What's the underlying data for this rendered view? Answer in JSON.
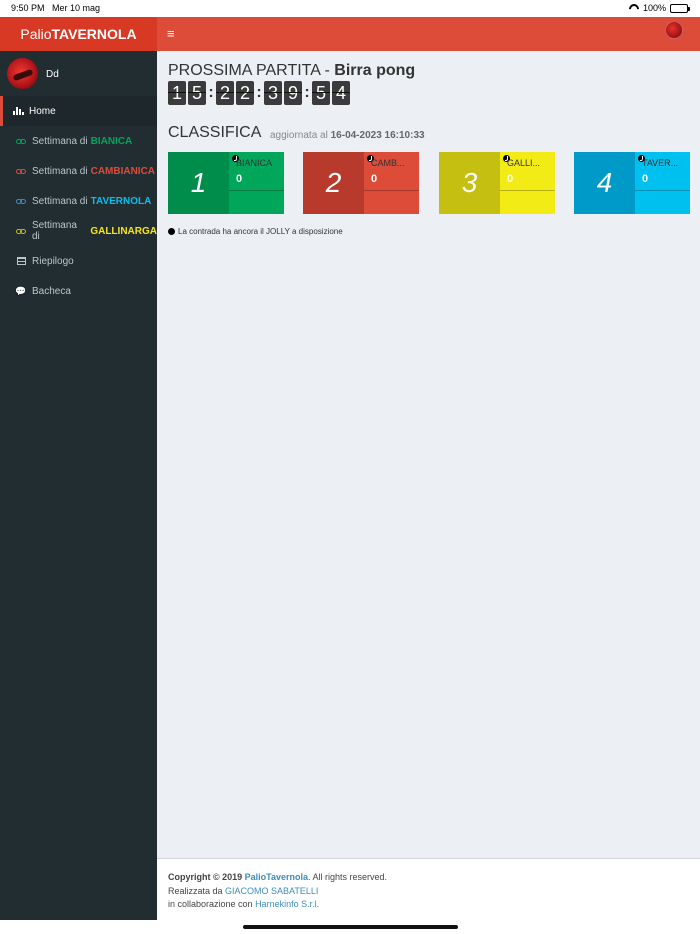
{
  "status_bar": {
    "time": "9:50 PM",
    "date": "Mer 10 mag",
    "battery": "100%"
  },
  "header": {
    "logo_light": "Palio",
    "logo_bold": "TAVERNOLA",
    "menu_icon": "hamburger-icon"
  },
  "user": {
    "name": "Dd"
  },
  "sidebar": {
    "items": [
      {
        "label": "Home",
        "icon": "bar-chart-icon",
        "active": true
      },
      {
        "label": "Settimana di ",
        "team": "BIANICA",
        "team_color": "#00a65a",
        "icon": "chain-icon"
      },
      {
        "label": "Settimana di ",
        "team": "CAMBIANICA",
        "team_color": "#dd4b39",
        "icon": "chain-icon"
      },
      {
        "label": "Settimana di ",
        "team": "TAVERNOLA",
        "team_color": "#00c0ef",
        "icon": "chain-icon"
      },
      {
        "label": "Settimana di ",
        "team": "GALLINARGA",
        "team_color": "#f5e61b",
        "icon": "chain-icon"
      },
      {
        "label": "Riepilogo",
        "icon": "table-icon"
      },
      {
        "label": "Bacheca",
        "icon": "comments-icon"
      }
    ]
  },
  "next_match": {
    "prefix": "PROSSIMA PARTITA - ",
    "name": "Birra pong",
    "countdown": [
      "1",
      "5",
      "2",
      "2",
      "3",
      "9",
      "5",
      "4"
    ]
  },
  "ranking": {
    "title": "CLASSIFICA",
    "updated_prefix": "aggiornata al ",
    "updated_value": "16-04-2023 16:10:33",
    "cards": [
      {
        "rank": "1",
        "name": "BIANICA",
        "score": "0",
        "dark": "#008d4c",
        "light": "#00a65a",
        "jolly": true
      },
      {
        "rank": "2",
        "name": "CAMB...",
        "score": "0",
        "dark": "#b83a2c",
        "light": "#dd4b39",
        "jolly": true
      },
      {
        "rank": "3",
        "name": "GALLI...",
        "score": "0",
        "dark": "#c5bf12",
        "light": "#f3eb15",
        "jolly": true
      },
      {
        "rank": "4",
        "name": "TAVER...",
        "score": "0",
        "dark": "#009ac8",
        "light": "#00c0ef",
        "jolly": true
      }
    ],
    "jolly_note": "La contrada ha ancora il JOLLY a disposizione"
  },
  "footer": {
    "copyright": "Copyright © 2019 ",
    "brand": "PalioTavernola",
    "rights": ". All rights reserved.",
    "made_by_prefix": "Realizzata da ",
    "author": "GIACOMO SABATELLI",
    "collab_prefix": "in collaborazione con ",
    "company": "Harnekinfo S.r.l."
  }
}
